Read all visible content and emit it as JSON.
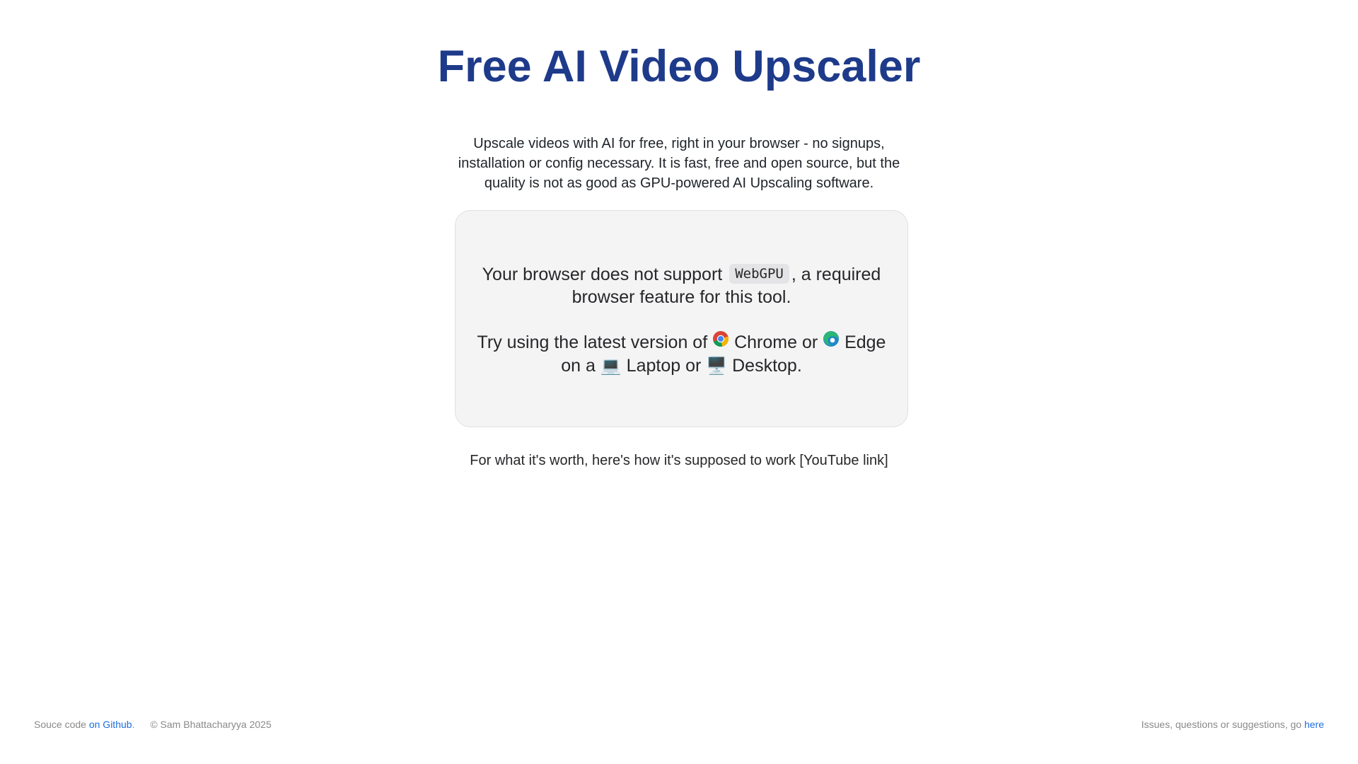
{
  "header": {
    "title": "Free AI Video Upscaler"
  },
  "intro": {
    "text": "Upscale videos with AI for free, right in your browser - no signups, installation or config necessary. It is fast, free and open source, but the quality is not as good as GPU-powered AI Upscaling software."
  },
  "notice": {
    "line1_before": "Your browser does not support",
    "code": "WebGPU",
    "line1_after": ", a required browser feature for this tool.",
    "line2_prefix": "Try using the latest version of",
    "chrome_label": "Chrome",
    "or1": "or",
    "edge_label": "Edge",
    "on_a": "on a",
    "laptop_emoji": "💻",
    "laptop_label": "Laptop",
    "or2": "or",
    "desktop_emoji": "🖥️",
    "desktop_label": "Desktop."
  },
  "worth": {
    "text": "For what it's worth, here's how it's supposed to work",
    "link": "[YouTube link]"
  },
  "footer": {
    "source_prefix": "Souce code",
    "github_link": "on Github",
    "source_suffix": ".",
    "copyright": "© Sam Bhattacharyya 2025",
    "issues_text": "Issues, questions or suggestions, go",
    "issues_link": "here"
  },
  "icons": {
    "chrome": "chrome-icon",
    "edge": "edge-icon",
    "laptop": "laptop-icon",
    "desktop": "desktop-icon"
  },
  "colors": {
    "title": "#1e3a8a",
    "link": "#1d6fe0",
    "card_bg": "#f4f4f5"
  }
}
